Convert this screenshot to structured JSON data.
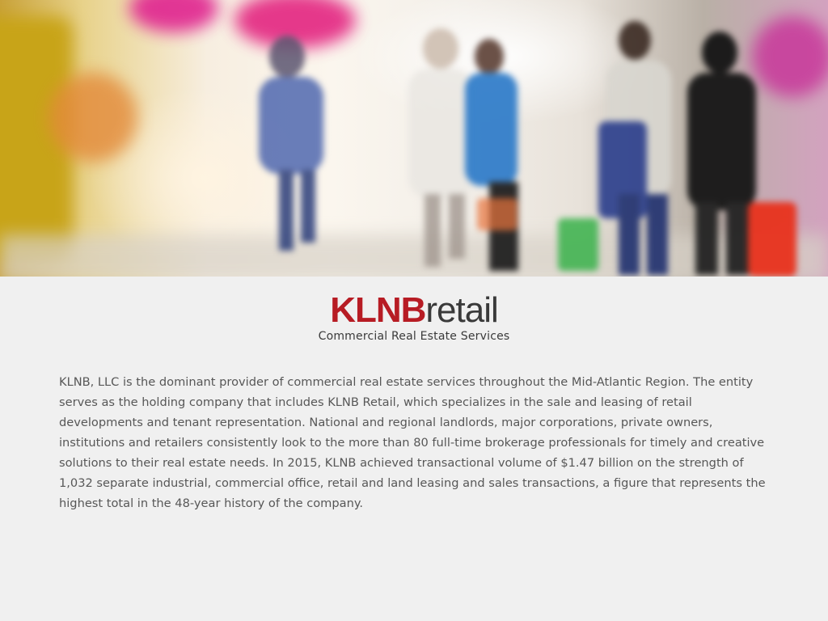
{
  "hero": {
    "image": "motion-blurred-shoppers-in-mall"
  },
  "logo": {
    "brand_bold": "KLNB",
    "brand_light": "retail",
    "tagline": "Commercial Real Estate Services",
    "brand_color": "#b71c24",
    "text_color": "#3a3a3a"
  },
  "description": {
    "text": "KLNB, LLC is the dominant provider of commercial real estate services throughout the Mid-Atlantic Region. The entity serves as the holding company that includes KLNB Retail, which specializes in the sale and leasing of retail developments and tenant representation. National and regional landlords, major corporations, private owners, institutions and retailers consistently look to the more than 80 full-time brokerage professionals for timely and creative solutions to their real estate needs. In 2015, KLNB achieved transactional volume of $1.47 billion on the strength of 1,032 separate industrial, commercial office, retail and land leasing and sales transactions, a figure that represents the highest total in the 48-year history of the company."
  }
}
